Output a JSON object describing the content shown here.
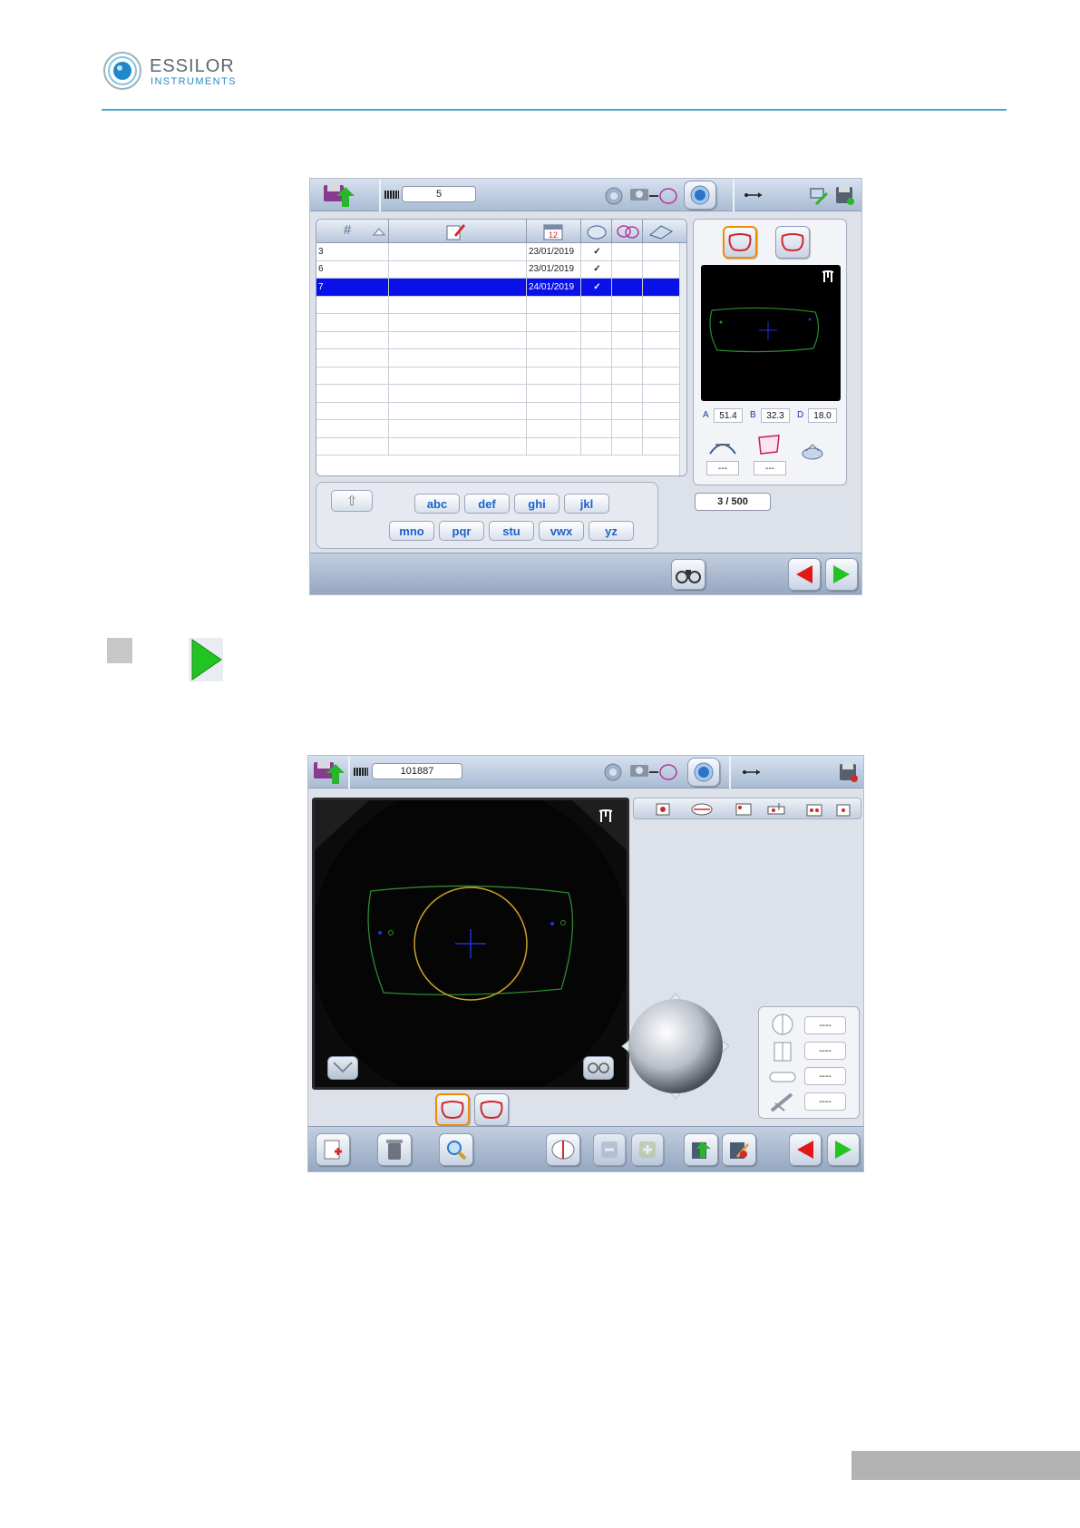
{
  "brand": {
    "name": "ESSILOR",
    "sub": "INSTRUMENTS"
  },
  "screen1": {
    "job_field": "5",
    "table": {
      "rows": [
        {
          "num": "3",
          "date": "23/01/2019",
          "check": "✓"
        },
        {
          "num": "6",
          "date": "23/01/2019",
          "check": "✓"
        },
        {
          "num": "7",
          "date": "24/01/2019",
          "check": "✓"
        }
      ],
      "selected_row": 2
    },
    "keyboard": {
      "shift": "⇧",
      "keys_row1": [
        "abc",
        "def",
        "ghi",
        "jkl"
      ],
      "keys_row2": [
        "mno",
        "pqr",
        "stu",
        "vwx",
        "yz"
      ]
    },
    "measures": {
      "a_label": "A",
      "a_value": "51.4",
      "b_label": "B",
      "b_value": "32.3",
      "d_label": "D",
      "d_value": "18.0"
    },
    "dash1": "---",
    "dash2": "---",
    "counter": "3 / 500"
  },
  "screen2": {
    "job_field": "101887",
    "side_values": [
      "----",
      "----",
      "----",
      "----"
    ]
  },
  "colors": {
    "accent": "#1b63c9",
    "selection": "#0a10e8",
    "next_arrow": "#22c422",
    "prev_arrow": "#e01818",
    "frame_outline": "#2e8b2e",
    "lens_circle": "#c9a227"
  }
}
